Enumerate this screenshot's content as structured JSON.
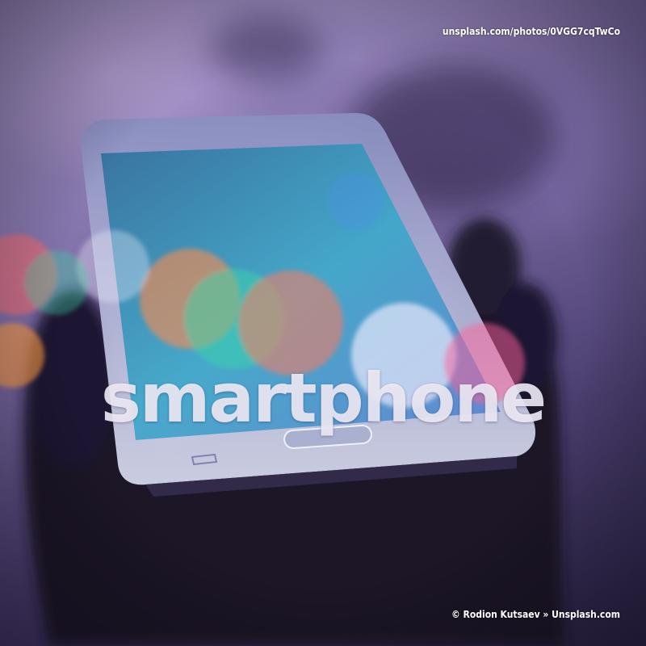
{
  "image": {
    "description_colors": {
      "background_top": "#a897c8",
      "background_bottom": "#2b2444",
      "phone_body": "#c9cfe6",
      "screen": "#3aa7c9",
      "bokeh_orange": "#ff8a4d",
      "bokeh_teal": "#39d6a8",
      "bokeh_pink": "#ff5f9a",
      "bokeh_white": "#f4f0ff"
    }
  },
  "overlay": {
    "source_url": "unsplash.com/photos/0VGG7cqTwCo",
    "headline": "smartphone",
    "credit": "© Rodion Kutsaev » Unsplash.com"
  }
}
